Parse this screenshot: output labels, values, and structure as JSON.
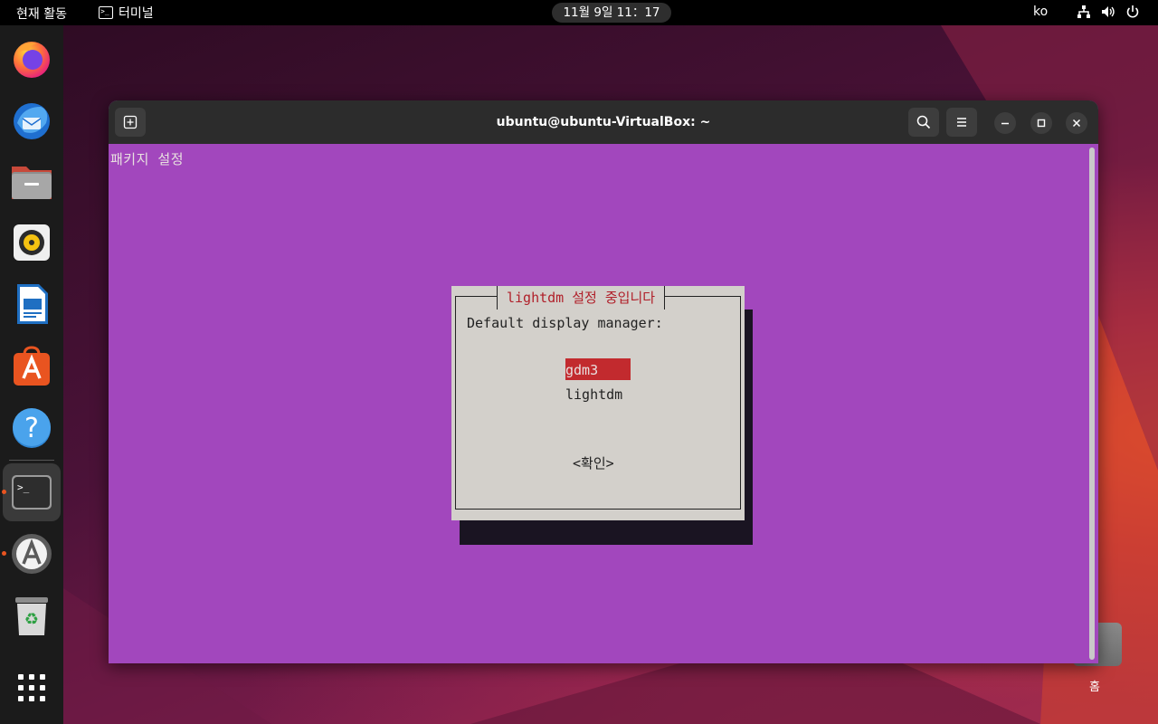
{
  "topbar": {
    "activities": "현재 활동",
    "app_name": "터미널",
    "clock": "11월 9일  11：17",
    "input_lang": "ko"
  },
  "dock": {
    "items": [
      {
        "name": "firefox-icon"
      },
      {
        "name": "thunderbird-icon"
      },
      {
        "name": "files-icon"
      },
      {
        "name": "rhythmbox-icon"
      },
      {
        "name": "libreoffice-writer-icon"
      },
      {
        "name": "app-center-icon"
      },
      {
        "name": "help-icon"
      },
      {
        "name": "terminal-icon",
        "running": true,
        "active": true
      },
      {
        "name": "software-updater-icon",
        "running": true
      },
      {
        "name": "trash-icon"
      },
      {
        "name": "show-apps-icon"
      }
    ]
  },
  "desktop": {
    "home_label": "홈"
  },
  "terminal": {
    "window_title": "ubuntu@ubuntu-VirtualBox: ~",
    "package_config_title": "패키지 설정",
    "dialog": {
      "title": "lightdm 설정 중입니다",
      "prompt": "Default display manager:",
      "options": [
        "gdm3",
        "lightdm"
      ],
      "selected": "gdm3",
      "ok_label": "<확인>"
    }
  },
  "colors": {
    "terminal_bg": "#a247bd",
    "dialog_bg": "#d3d0cb",
    "dialog_title": "#b0202a",
    "selection_bg": "#c22a2e",
    "ubuntu_orange": "#e95420"
  }
}
